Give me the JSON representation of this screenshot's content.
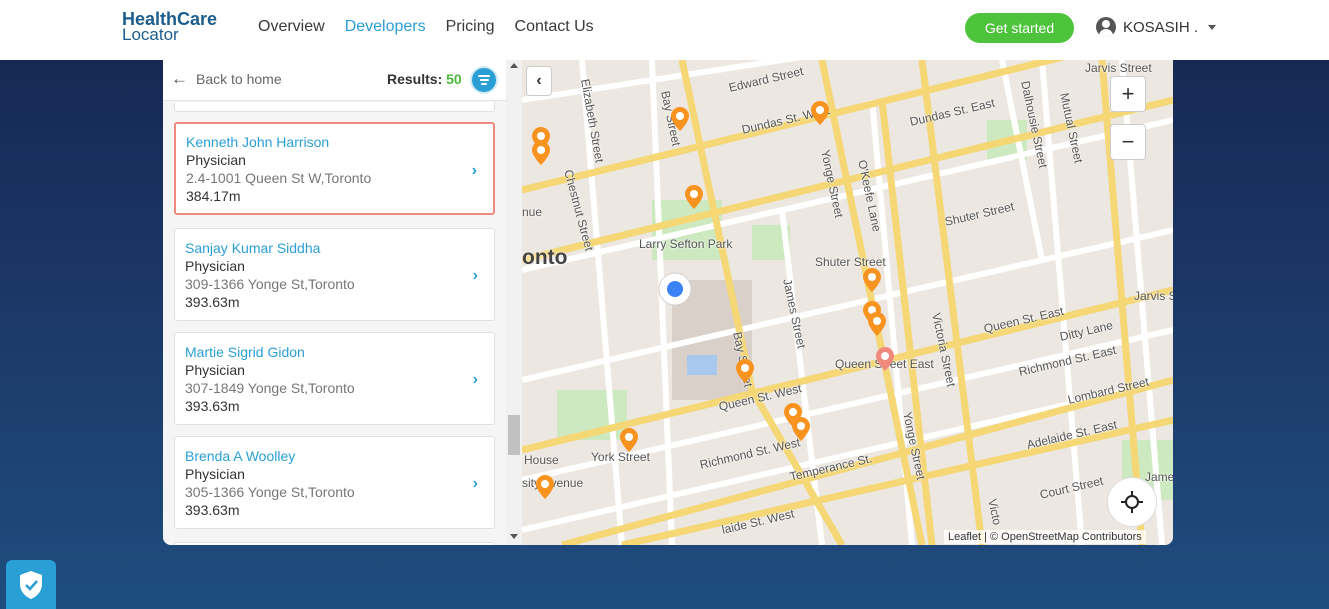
{
  "header": {
    "logo_line1": "HealthCare",
    "logo_line2": "Locator",
    "nav": [
      "Overview",
      "Developers",
      "Pricing",
      "Contact Us"
    ],
    "active_nav": "Developers",
    "cta_label": "Get started",
    "user_name": "KOSASIH ."
  },
  "panel": {
    "back_label": "Back to home",
    "results_label": "Results:",
    "results_count": "50",
    "items": [
      {
        "name": "Kenneth John Harrison",
        "specialty": "Physician",
        "address": "2.4-1001 Queen St W,Toronto",
        "distance": "384.17m",
        "selected": true
      },
      {
        "name": "Sanjay Kumar Siddha",
        "specialty": "Physician",
        "address": "309-1366 Yonge St,Toronto",
        "distance": "393.63m",
        "selected": false
      },
      {
        "name": "Martie Sigrid Gidon",
        "specialty": "Physician",
        "address": "307-1849 Yonge St,Toronto",
        "distance": "393.63m",
        "selected": false
      },
      {
        "name": "Brenda A Woolley",
        "specialty": "Physician",
        "address": "305-1366 Yonge St,Toronto",
        "distance": "393.63m",
        "selected": false
      }
    ]
  },
  "map": {
    "streets": {
      "edward": "Edward Street",
      "jarvis_top": "Jarvis Street",
      "dundas_w": "Dundas St. West",
      "dundas_e": "Dundas St. East",
      "dalhousie": "Dalhousie Street",
      "mutual": "Mutual Street",
      "elizabeth": "Elizabeth Street",
      "bay_top": "Bay Street",
      "chestnut": "Chestnut Street",
      "yonge_top": "Yonge Street",
      "okeefe": "O'Keefe Lane",
      "shuter_e": "Shuter Street",
      "larry": "Larry Sefton Park",
      "shuter": "Shuter Street",
      "jarvis_right": "Jarvis St",
      "james": "James Street",
      "victoria": "Victoria Street",
      "queen_e": "Queen St. East",
      "queen_e2": "Queen Street East",
      "ditty": "Ditty Lane",
      "richmond_e": "Richmond St. East",
      "bay_mid": "Bay Street",
      "queen_w": "Queen St. West",
      "lombard": "Lombard Street",
      "yonge_mid": "Yonge Street",
      "york": "York Street",
      "richmond_w": "Richmond St. West",
      "adelaide": "Adelaide St. East",
      "house": "House",
      "venue": "sity Avenue",
      "temperance": "Temperance St.",
      "court": "Court Street",
      "vic_bottom": "Victo",
      "james_bottom": "Jame",
      "adelaide_w": "laide St. West",
      "nue": "nue",
      "onto": "onto"
    },
    "attribution": "Leaflet | © OpenStreetMap Contributors",
    "zoom_in": "+",
    "zoom_out": "−",
    "pin_color": "#f7931e",
    "selected_pin_color": "#f08a7e",
    "user_location_color": "#3b82f6"
  }
}
